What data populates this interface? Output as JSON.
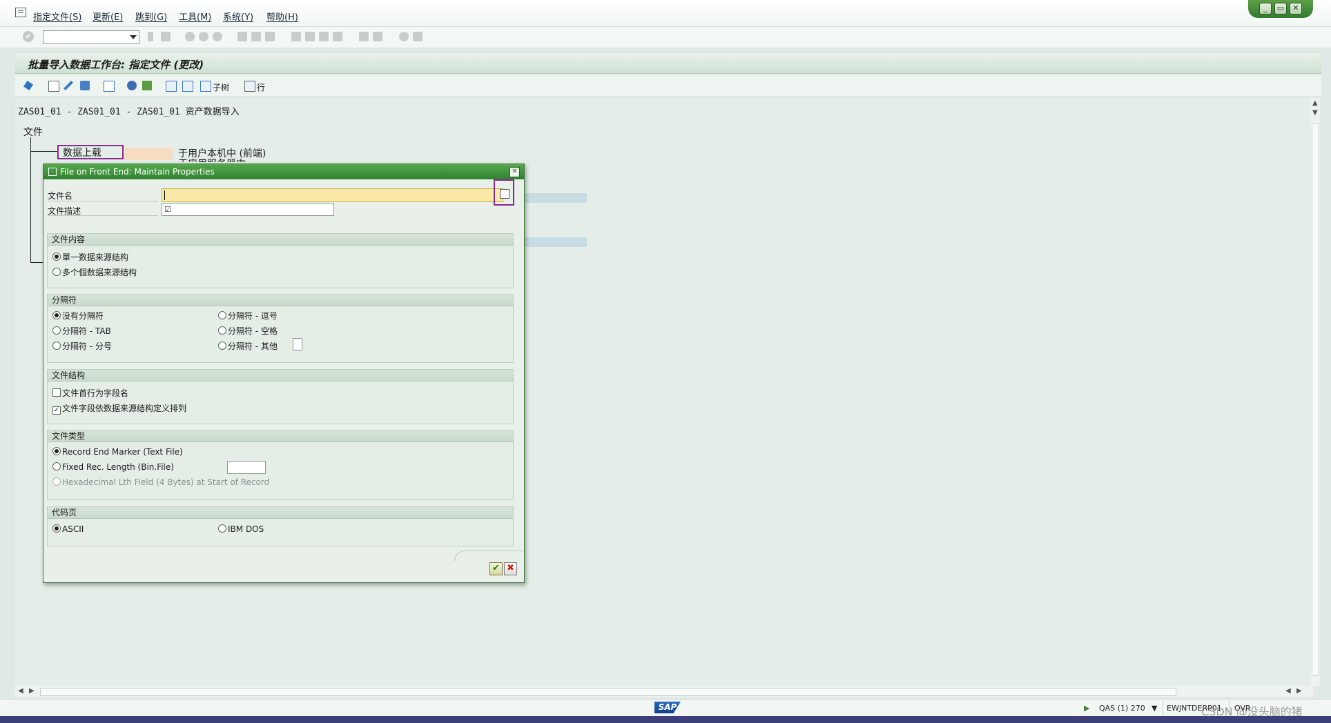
{
  "menu": {
    "items": [
      "指定文件(S)",
      "更新(E)",
      "跳到(G)",
      "工具(M)",
      "系统(Y)",
      "帮助(H)"
    ]
  },
  "window_controls": {
    "minimize": "_",
    "restore": "▭",
    "close": "✕"
  },
  "page": {
    "title": "批量导入数据工作台: 指定文件 (更改)"
  },
  "app_toolbar": {
    "subtree_label": "子树",
    "row_label": "行"
  },
  "content": {
    "breadcrumb": "ZAS01_01 - ZAS01_01 - ZAS01_01 资产数据导入",
    "tree_root": "文件",
    "tree_upload": "数据上载",
    "tree_upload_desc": "于用户本机中 (前端)",
    "tree_upload_desc2": "于应用服务器中"
  },
  "dialog": {
    "title": "File on Front End: Maintain Properties",
    "filename_label": "文件名",
    "filename_value": "",
    "description_label": "文件描述",
    "description_check": "☑",
    "groups": {
      "content": {
        "title": "文件内容",
        "options": [
          {
            "label": "單一数据来源结构",
            "selected": true
          },
          {
            "label": "多个個数据来源结构",
            "selected": false
          }
        ]
      },
      "separator": {
        "title": "分隔符",
        "options": [
          {
            "label": "没有分隔符",
            "selected": true
          },
          {
            "label": "分隔符 - TAB",
            "selected": false
          },
          {
            "label": "分隔符 -  分号",
            "selected": false
          },
          {
            "label": "分隔符 -  逗号",
            "selected": false
          },
          {
            "label": "分隔符 -  空格",
            "selected": false
          },
          {
            "label": "分隔符 -  其他",
            "selected": false
          }
        ]
      },
      "structure": {
        "title": "文件结构",
        "options": [
          {
            "label": "文件首行为字段名",
            "checked": false
          },
          {
            "label": "文件字段依数据来源结构定义排列",
            "checked": true
          }
        ]
      },
      "type": {
        "title": "文件类型",
        "options": [
          {
            "label": "Record End Marker (Text File)",
            "selected": true
          },
          {
            "label": "Fixed Rec. Length (Bin.File)",
            "selected": false
          },
          {
            "label": "Hexadecimal Lth Field (4 Bytes) at Start of Record",
            "selected": false,
            "disabled": true
          }
        ]
      },
      "codepage": {
        "title": "代码页",
        "options": [
          {
            "label": "ASCII",
            "selected": true
          },
          {
            "label": "IBM DOS",
            "selected": false
          }
        ]
      }
    },
    "ok_symbol": "✔",
    "cancel_symbol": "✖"
  },
  "status": {
    "system": "QAS (1) 270",
    "server": "EWJNTDERP01",
    "mode": "OVR"
  },
  "sap_logo": "SAP",
  "watermark": "CSDN @没头脑的猪",
  "colors": {
    "accent_green": "#2f8231",
    "highlight_purple": "#8b2a8c",
    "input_yellow": "#fbe9a7"
  }
}
